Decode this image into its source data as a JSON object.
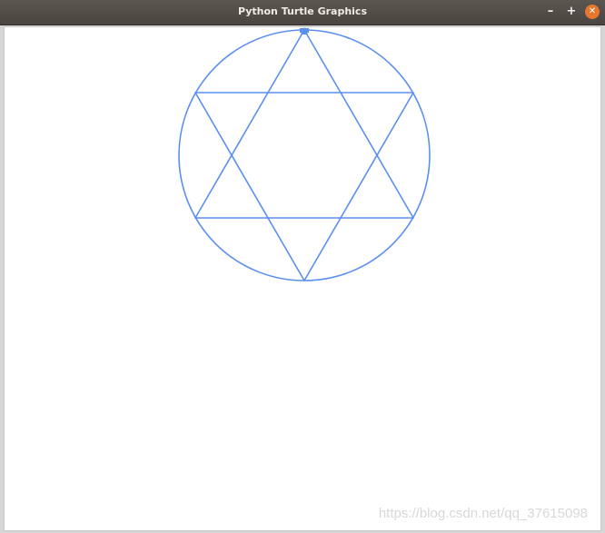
{
  "window": {
    "title": "Python Turtle Graphics",
    "controls": {
      "minimize_symbol": "–",
      "maximize_symbol": "+",
      "close_symbol": "✕"
    },
    "close_color": "#e8772e"
  },
  "drawing": {
    "pen_color": "#5b8ff0",
    "shapes": [
      "circle",
      "upward-triangle",
      "downward-triangle"
    ],
    "turtle_cursor": "classic-arrow"
  },
  "watermark": "https://blog.csdn.net/qq_37615098"
}
